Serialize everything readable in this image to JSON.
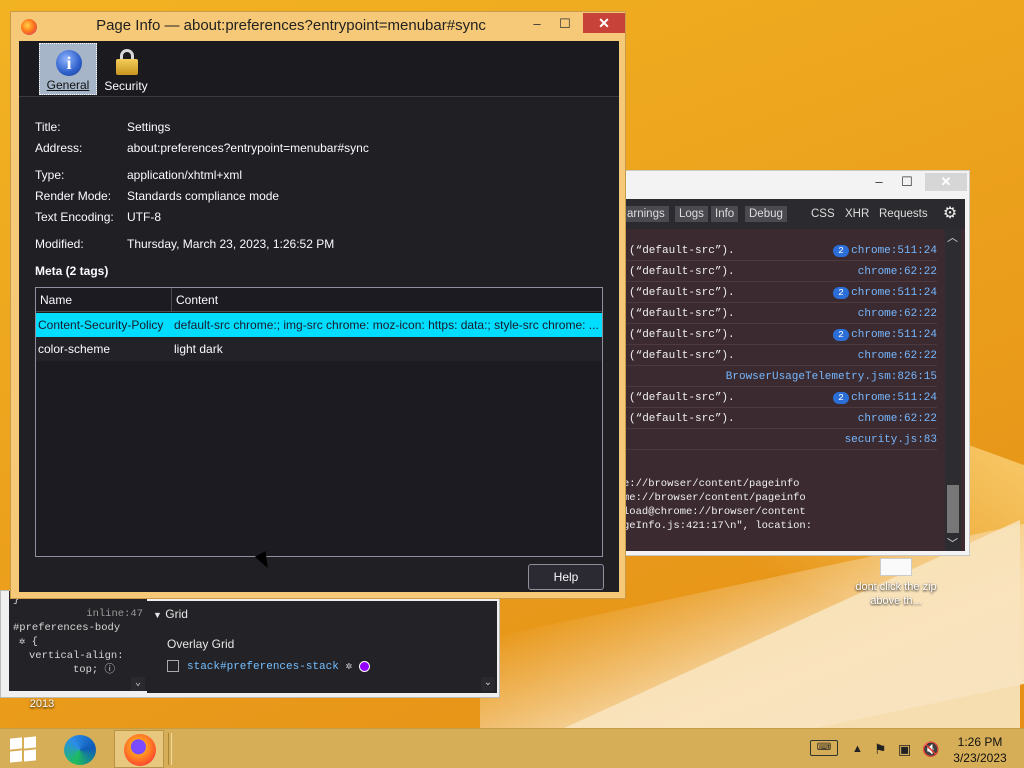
{
  "dialog": {
    "title": "Page Info — about:preferences?entrypoint=menubar#sync",
    "tabs": [
      {
        "label": "General",
        "selected": true
      },
      {
        "label": "Security",
        "selected": false
      }
    ],
    "fields": {
      "title": {
        "label": "Title:",
        "value": "Settings"
      },
      "address": {
        "label": "Address:",
        "value": "about:preferences?entrypoint=menubar#sync"
      },
      "type": {
        "label": "Type:",
        "value": "application/xhtml+xml"
      },
      "render_mode": {
        "label": "Render Mode:",
        "value": "Standards compliance mode"
      },
      "encoding": {
        "label": "Text Encoding:",
        "value": "UTF-8"
      },
      "modified": {
        "label": "Modified:",
        "value": "Thursday, March 23, 2023, 1:26:52 PM"
      }
    },
    "meta_heading": "Meta (2 tags)",
    "meta_columns": [
      "Name",
      "Content"
    ],
    "meta_rows": [
      {
        "name": "Content-Security-Policy",
        "content": "default-src chrome:; img-src chrome: moz-icon: https: data:; style-src chrome: ..."
      },
      {
        "name": "color-scheme",
        "content": "light dark"
      }
    ],
    "help_label": "Help",
    "selection_color": "#00ddff"
  },
  "console": {
    "tabs": [
      "arnings",
      "Logs",
      "Info",
      "Debug",
      "CSS",
      "XHR",
      "Requests"
    ],
    "rows": [
      {
        "msg": "(“default-src”).",
        "badge": "2",
        "src": "chrome:511:24"
      },
      {
        "msg": "(“default-src”).",
        "badge": "",
        "src": "chrome:62:22"
      },
      {
        "msg": "(“default-src”).",
        "badge": "2",
        "src": "chrome:511:24"
      },
      {
        "msg": "(“default-src”).",
        "badge": "",
        "src": "chrome:62:22"
      },
      {
        "msg": "(“default-src”).",
        "badge": "2",
        "src": "chrome:511:24"
      },
      {
        "msg": "(“default-src”).",
        "badge": "",
        "src": "chrome:62:22"
      },
      {
        "msg": "",
        "badge": "",
        "src": "BrowserUsageTelemetry.jsm:826:15"
      },
      {
        "msg": "(“default-src”).",
        "badge": "2",
        "src": "chrome:511:24"
      },
      {
        "msg": "(“default-src”).",
        "badge": "",
        "src": "chrome:62:22"
      },
      {
        "msg": "",
        "badge": "",
        "src": "security.js:83"
      }
    ],
    "stack": [
      "e://browser/content/pageinfo",
      "me://browser/content/pageinfo",
      "load@chrome://browser/content",
      "geInfo.js:421:17\\n\", location:"
    ]
  },
  "inspector": {
    "left_lines": [
      "}",
      "inline:47",
      "#preferences-body",
      "{",
      "vertical-align:",
      "top;"
    ],
    "grid_heading": "Grid",
    "overlay_label": "Overlay Grid",
    "grid_item": "stack#preferences-stack"
  },
  "desktop": {
    "file_label": "dont click the zip above th...",
    "year_label": "2013"
  },
  "taskbar": {
    "time": "1:26 PM",
    "date": "3/23/2023"
  }
}
